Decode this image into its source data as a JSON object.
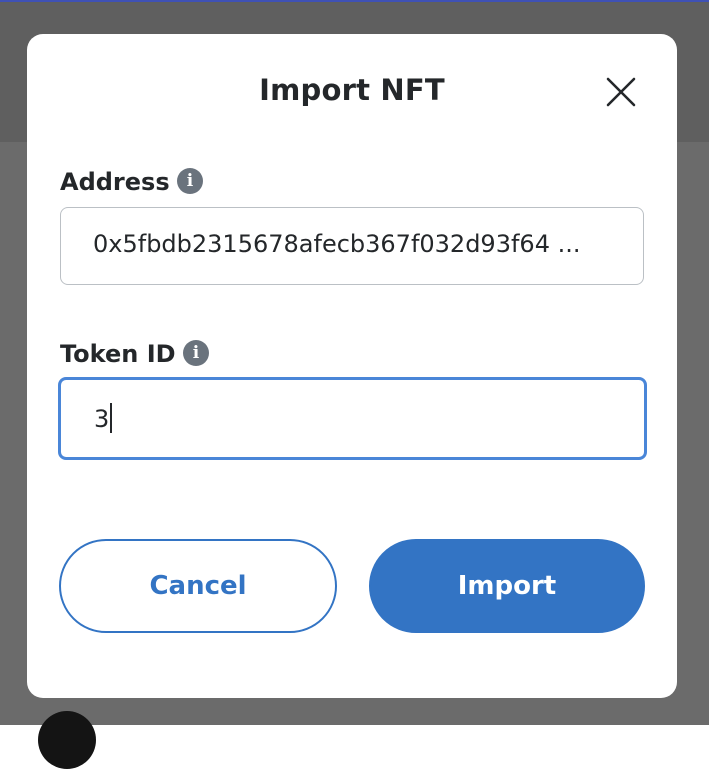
{
  "modal": {
    "title": "Import NFT",
    "address_label": "Address",
    "address_value": "0x5fbdb2315678afecb367f032d93f64 ...",
    "token_id_label": "Token ID",
    "token_id_value": "3",
    "info_glyph": "i",
    "cancel_label": "Cancel",
    "import_label": "Import"
  },
  "icons": {
    "close": "close-icon",
    "info": "info-icon"
  },
  "colors": {
    "primary": "#3374c4",
    "focus_border": "#4a86d8",
    "text": "#24272a",
    "info_icon": "#6a737d"
  }
}
